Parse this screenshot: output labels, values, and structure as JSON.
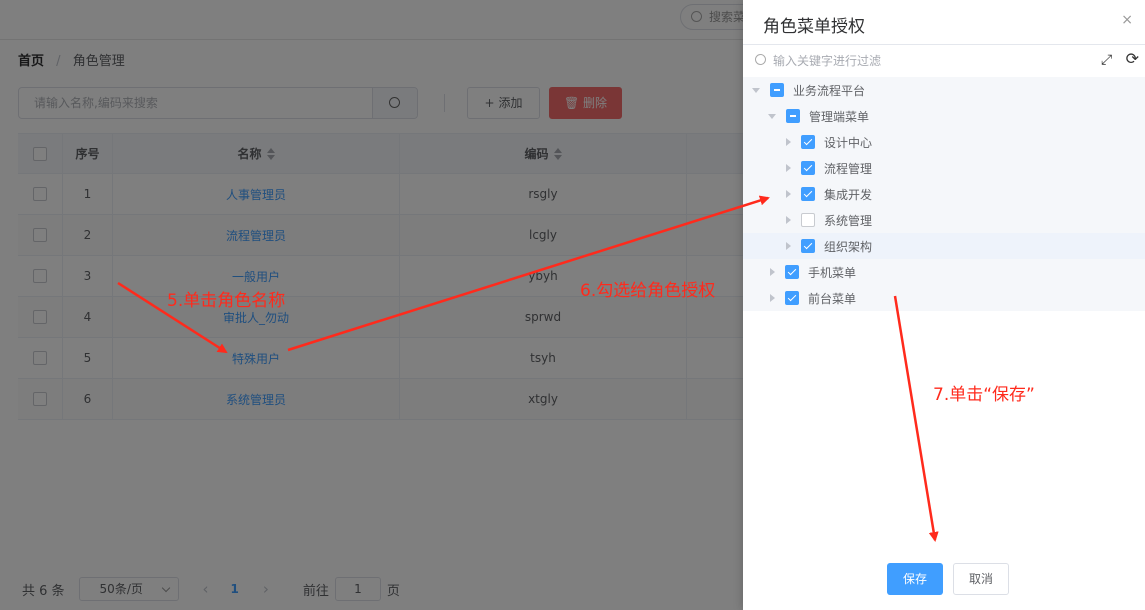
{
  "topbar": {
    "search_placeholder": "搜索菜"
  },
  "breadcrumb": {
    "home": "首页",
    "separator": "/",
    "current": "角色管理"
  },
  "toolbar": {
    "search_placeholder": "请输入名称,编码来搜索",
    "add_label": "添加",
    "delete_label": "删除"
  },
  "table": {
    "headers": {
      "index": "序号",
      "name": "名称",
      "code": "编码"
    },
    "rows": [
      {
        "index": "1",
        "name": "人事管理员",
        "code": "rsgly"
      },
      {
        "index": "2",
        "name": "流程管理员",
        "code": "lcgly"
      },
      {
        "index": "3",
        "name": "一般用户",
        "code": "ybyh"
      },
      {
        "index": "4",
        "name": "审批人_勿动",
        "code": "sprwd"
      },
      {
        "index": "5",
        "name": "特殊用户",
        "code": "tsyh"
      },
      {
        "index": "6",
        "name": "系统管理员",
        "code": "xtgly"
      }
    ]
  },
  "pagination": {
    "total": "共 6 条",
    "page_size": "50条/页",
    "current_page": "1",
    "goto_label": "前往",
    "goto_value": "1",
    "page_suffix": "页"
  },
  "drawer": {
    "title": "角色菜单授权",
    "close": "×",
    "filter_placeholder": "输入关键字进行过滤",
    "tree": [
      {
        "label": "业务流程平台",
        "state": "indeterminate",
        "level": 0,
        "expanded": true
      },
      {
        "label": "管理端菜单",
        "state": "indeterminate",
        "level": 1,
        "expanded": true
      },
      {
        "label": "设计中心",
        "state": "checked",
        "level": 2
      },
      {
        "label": "流程管理",
        "state": "checked",
        "level": 2
      },
      {
        "label": "集成开发",
        "state": "checked",
        "level": 2
      },
      {
        "label": "系统管理",
        "state": "unchecked",
        "level": 2
      },
      {
        "label": "组织架构",
        "state": "checked",
        "level": 2
      },
      {
        "label": "手机菜单",
        "state": "checked",
        "level": 1
      },
      {
        "label": "前台菜单",
        "state": "checked",
        "level": 1
      }
    ],
    "save_label": "保存",
    "cancel_label": "取消"
  },
  "annotations": {
    "step5": "5.单击角色名称",
    "step6": "6.勾选给角色授权",
    "step7": "7.单击“保存”"
  },
  "colors": {
    "primary": "#409eff",
    "danger": "#f56c6c",
    "annotation": "#ff2a1c"
  }
}
